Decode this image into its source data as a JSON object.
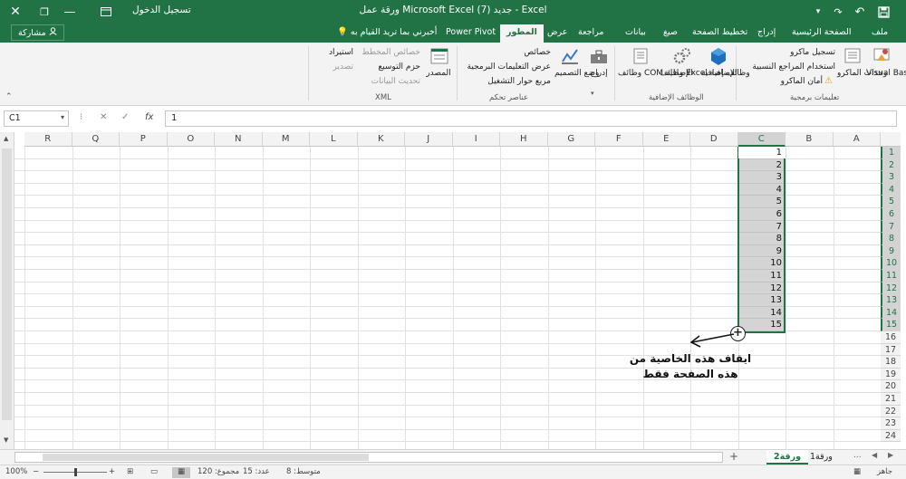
{
  "titlebar": {
    "title": "ورقة عمل Microsoft Excel جديد (7) - Excel",
    "signin": "تسجيل الدخول"
  },
  "tabs": {
    "file": "ملف",
    "home": "الصفحة الرئيسية",
    "insert": "إدراج",
    "page_layout": "تخطيط الصفحة",
    "formulas": "صيغ",
    "data": "بيانات",
    "review": "مراجعة",
    "view": "عرض",
    "developer": "المطور",
    "power_pivot": "Power Pivot",
    "tell_me": "أخبرني بما تريد القيام به",
    "share": "مشاركة"
  },
  "ribbon": {
    "code": {
      "visual_basic": "Visual Basic",
      "macros": "وحدات الماكرو",
      "record_macro": "تسجيل ماكرو",
      "relative_refs": "استخدام المراجع النسبية",
      "macro_security": "أمان الماكرو",
      "label": "تعليمات برمجية"
    },
    "addins": {
      "addins": "وظائف إضافية",
      "excel_addins": "وظائف Excel الإضافية",
      "com_addins": "وظائف COM الإضافية",
      "label": "الوظائف الإضافية"
    },
    "controls": {
      "insert": "إدراج",
      "design_mode": "وضع التصميم",
      "properties": "خصائص",
      "view_code": "عرض التعليمات البرمجية",
      "run_dialog": "مربع حوار التشغيل",
      "label": "عناصر تحكم"
    },
    "xml": {
      "source": "المصدر",
      "map_properties": "خصائص المخطط",
      "expansion_packs": "حزم التوسيع",
      "refresh_data": "تحديث البيانات",
      "import": "استيراد",
      "export": "تصدير",
      "label": "XML"
    }
  },
  "formula_bar": {
    "name_box": "C1",
    "value": "1",
    "fx": "fx"
  },
  "sheet": {
    "columns": [
      "A",
      "B",
      "C",
      "D",
      "E",
      "F",
      "G",
      "H",
      "I",
      "J",
      "K",
      "L",
      "M",
      "N",
      "O",
      "P",
      "Q",
      "R"
    ],
    "selected_column": "C",
    "rows": [
      "1",
      "2",
      "3",
      "4",
      "5",
      "6",
      "7",
      "8",
      "9",
      "10",
      "11",
      "12",
      "13",
      "14",
      "15",
      "16",
      "17",
      "18",
      "19",
      "20",
      "21",
      "22",
      "23",
      "24"
    ],
    "selected_rows": 15,
    "cells_c": [
      "1",
      "2",
      "3",
      "4",
      "5",
      "6",
      "7",
      "8",
      "9",
      "10",
      "11",
      "12",
      "13",
      "14",
      "15"
    ],
    "annotation_line1": "ايقاف هذه الخاصية من",
    "annotation_line2": "هذه الصفحة فقط"
  },
  "sheet_tabs": {
    "sheet1": "ورقة1",
    "sheet2": "ورقة2",
    "add": "+"
  },
  "status": {
    "ready": "جاهز",
    "average": "متوسط: 8",
    "count": "عدد: 15",
    "sum": "مجموع: 120",
    "zoom": "100%"
  },
  "colors": {
    "excel_green": "#217346",
    "selection_gray": "#a0a0a0"
  }
}
